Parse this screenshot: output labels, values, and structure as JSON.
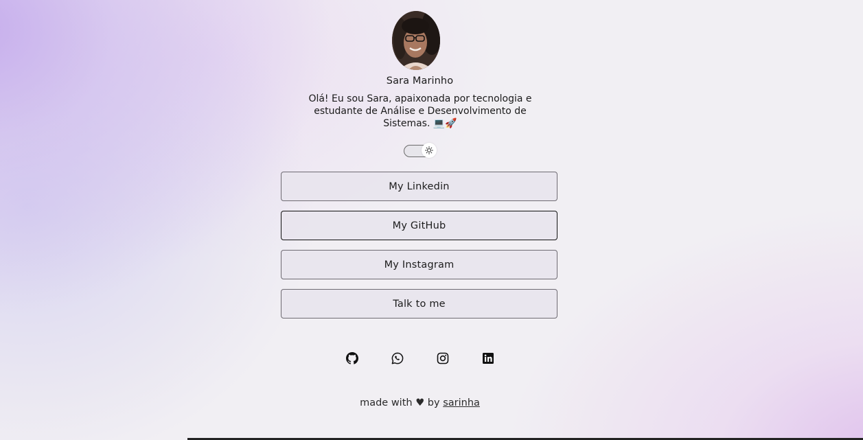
{
  "profile": {
    "name": "Sara Marinho",
    "bio": "Olá! Eu sou Sara, apaixonada por tecnologia e estudante de Análise e Desenvolvimento de Sistemas. 💻🚀"
  },
  "theme_toggle": {
    "icon": "sun-icon",
    "mode": "light"
  },
  "links": [
    {
      "label": "My Linkedin"
    },
    {
      "label": "My GitHub"
    },
    {
      "label": "My Instagram"
    },
    {
      "label": "Talk to me"
    }
  ],
  "social_icons": [
    "github-icon",
    "whatsapp-icon",
    "instagram-icon",
    "linkedin-icon"
  ],
  "footer": {
    "prefix": "made with ♥ by",
    "author": "sarinha"
  },
  "colors": {
    "accent_purple": "#c4aaec",
    "accent_pink": "#debeec",
    "button_border": "#6e6a72"
  }
}
